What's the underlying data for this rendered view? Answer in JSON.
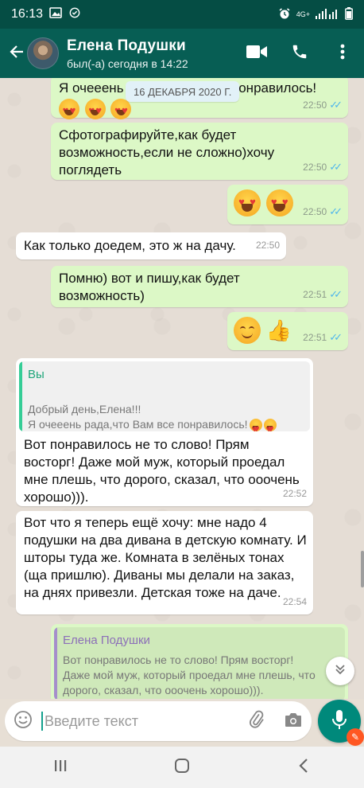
{
  "status_bar": {
    "time": "16:13",
    "network": "4G+",
    "icons": [
      "gallery-icon",
      "check-circle-icon",
      "alarm-icon",
      "signal-icon",
      "battery-icon"
    ]
  },
  "header": {
    "contact_name": "Елена Подушки",
    "last_seen": "был(-а) сегодня в 14:22",
    "icons": [
      "back-arrow-icon",
      "video-call-icon",
      "phone-icon",
      "more-vert-icon"
    ]
  },
  "chat": {
    "date_pill": "16 ДЕКАБРЯ 2020 Г.",
    "messages": [
      {
        "dir": "out",
        "text_left": "Я очееень",
        "text_right": "понравилось!",
        "time": "22:50",
        "emoji": "heart-eyes x3"
      },
      {
        "dir": "out",
        "text": "Сфотографируйте,как будет возможность,если не сложно)хочу поглядеть",
        "time": "22:50"
      },
      {
        "dir": "out",
        "text": "",
        "time": "22:50",
        "emoji": "heart-eyes x2"
      },
      {
        "dir": "in",
        "text": "Как только доедем, это ж на дачу.",
        "time": "22:50"
      },
      {
        "dir": "out",
        "text": "Помню) вот и пишу,как будет возможность)",
        "time": "22:51"
      },
      {
        "dir": "out",
        "text": "",
        "time": "22:51",
        "emoji": "smile thumbs-up"
      },
      {
        "dir": "in",
        "quote_author": "Вы",
        "quote_text": "Добрый день,Елена!!!\nЯ очееень рада,что Вам все понравилось!",
        "text": "Вот понравилось не то слово! Прям восторг! Даже мой муж, который проедал мне плешь, что дорого, сказал, что ооочень хорошо))).",
        "time": "22:52"
      },
      {
        "dir": "in",
        "text": "Вот что я теперь ещё хочу: мне надо 4 подушки на два дивана в детскую комнату. И шторы туда же. Комната в зелёных тонах (ща пришлю). Диваны мы делали на заказ, на днях привезли. Детская тоже на даче.",
        "time": "22:54"
      },
      {
        "dir": "out",
        "quote_author": "Елена Подушки",
        "quote_text": "Вот понравилось не то слово! Прям восторг! Даже мой муж, который проедал мне плешь, что дорого, сказал, что ооочень хорошо)))."
      }
    ]
  },
  "input": {
    "placeholder": "Введите текст",
    "value": ""
  },
  "colors": {
    "header": "#075e54",
    "status_bar": "#054d44",
    "outgoing_bubble": "#dcf8c6",
    "incoming_bubble": "#ffffff",
    "accent": "#00897b",
    "read_ticks": "#4fb6ec"
  }
}
